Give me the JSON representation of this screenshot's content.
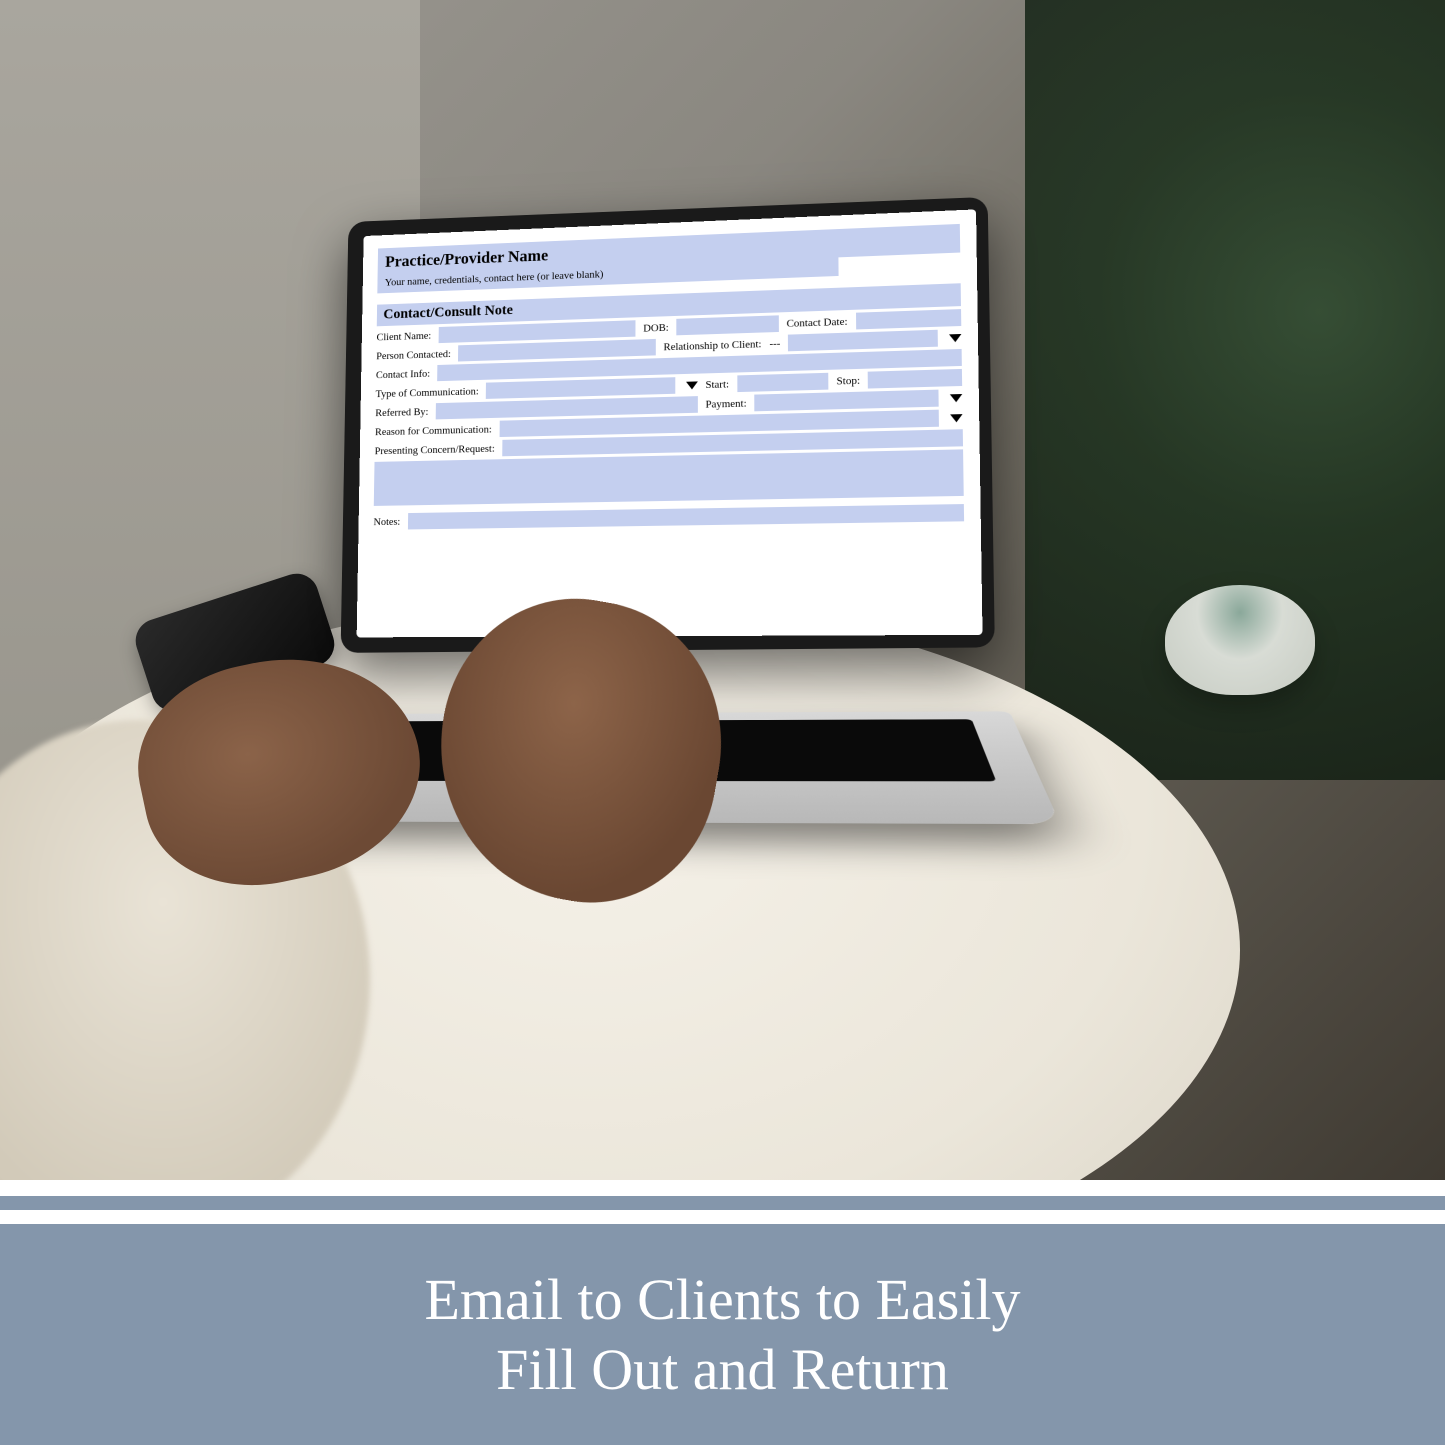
{
  "form": {
    "header_title": "Practice/Provider Name",
    "header_subtitle": "Your name, credentials, contact here (or leave blank)",
    "section_title": "Contact/Consult Note",
    "labels": {
      "client_name": "Client Name:",
      "dob": "DOB:",
      "contact_date": "Contact Date:",
      "person_contacted": "Person Contacted:",
      "relationship": "Relationship to Client:",
      "relationship_value": "---",
      "contact_info": "Contact Info:",
      "type_comm": "Type of Communication:",
      "start": "Start:",
      "stop": "Stop:",
      "referred_by": "Referred By:",
      "payment": "Payment:",
      "reason": "Reason for Communication:",
      "presenting": "Presenting Concern/Request:",
      "notes": "Notes:"
    }
  },
  "banner": {
    "line1": "Email to Clients to Easily",
    "line2": "Fill Out and Return"
  },
  "colors": {
    "field_bg": "#c4cfef",
    "banner_bg": "#8496ab",
    "banner_text": "#ffffff"
  }
}
